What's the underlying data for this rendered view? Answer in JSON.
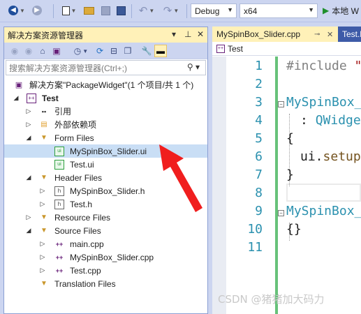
{
  "toolbar": {
    "config_value": "Debug",
    "platform_value": "x64",
    "run_label": "本地 W"
  },
  "solution_explorer": {
    "title": "解决方案资源管理器",
    "search_placeholder": "搜索解决方案资源管理器(Ctrl+;)",
    "tree": {
      "solution": "解决方案\"PackageWidget\"(1 个项目/共 1 个)",
      "project": "Test",
      "references": "引用",
      "external_deps": "外部依赖项",
      "form_files": "Form Files",
      "form_file_1": "MySpinBox_Slider.ui",
      "form_file_2": "Test.ui",
      "header_files": "Header Files",
      "header_file_1": "MySpinBox_Slider.h",
      "header_file_2": "Test.h",
      "resource_files": "Resource Files",
      "source_files": "Source Files",
      "source_file_1": "main.cpp",
      "source_file_2": "MySpinBox_Slider.cpp",
      "source_file_3": "Test.cpp",
      "translation_files": "Translation Files"
    }
  },
  "editor": {
    "tabs": [
      {
        "label": "MySpinBox_Slider.cpp"
      },
      {
        "label": "Test.h"
      }
    ],
    "nav_scope": "Test",
    "line_numbers": [
      "1",
      "2",
      "3",
      "4",
      "5",
      "6",
      "7",
      "8",
      "9",
      "10",
      "11"
    ],
    "code": {
      "l1_directive": "#include ",
      "l1_string": "\"M",
      "l3_name": "MySpinBox_",
      "l4_colon": ": ",
      "l4_base": "QWidge",
      "l5_brace": "{",
      "l6_obj": "ui.",
      "l6_call": "setupU",
      "l7_brace": "}",
      "l9_name": "MySpinBox_",
      "l10_body": "{}"
    }
  },
  "watermark": "CSDN @猪猪加大码力",
  "colors": {
    "selection": "#c9def5",
    "title_highlight": "#fff1b8",
    "annotation_arrow": "#f01e1e",
    "modified_bar": "#67c27a"
  }
}
